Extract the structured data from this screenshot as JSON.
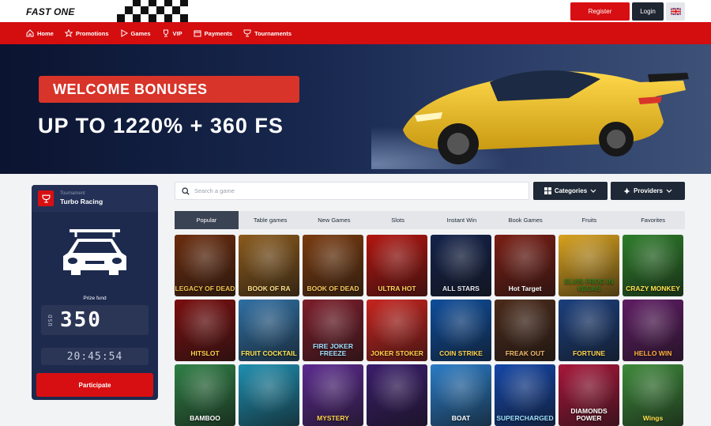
{
  "header": {
    "logo_main": "FAST",
    "logo_accent": " ONE",
    "register_label": "Register",
    "login_label": "Login",
    "language_icon": "uk-flag-icon"
  },
  "nav": {
    "items": [
      {
        "label": "Home",
        "icon": "home-icon"
      },
      {
        "label": "Promotions",
        "icon": "star-icon"
      },
      {
        "label": "Games",
        "icon": "play-icon"
      },
      {
        "label": "VIP",
        "icon": "trophy-icon"
      },
      {
        "label": "Payments",
        "icon": "wallet-icon"
      },
      {
        "label": "Tournaments",
        "icon": "cup-icon"
      }
    ]
  },
  "hero": {
    "tag": "WELCOME BONUSES",
    "headline": "UP TO 1220% + 360 FS"
  },
  "tournament": {
    "subtitle": "Tournament",
    "title": "Turbo Racing",
    "prize_label": "Prize fund",
    "currency": "USD",
    "prize_value": "350",
    "timer": "20:45:54",
    "participate_label": "Participate"
  },
  "search": {
    "placeholder": "Search a game",
    "value": ""
  },
  "filters": {
    "categories_label": "Categories",
    "providers_label": "Providers"
  },
  "tabs": [
    "Popular",
    "Table games",
    "New Games",
    "Slots",
    "Instant Win",
    "Book Games",
    "Fruits",
    "Favorites"
  ],
  "active_tab": "Popular",
  "games": [
    {
      "name": "LEGACY OF DEAD",
      "bg": "#6b2c0d",
      "fg": "#f2c24a"
    },
    {
      "name": "BOOK OF RA",
      "bg": "#8a5a1c",
      "fg": "#ffe08a"
    },
    {
      "name": "BOOK OF DEAD",
      "bg": "#7a3b0f",
      "fg": "#f7c95b"
    },
    {
      "name": "ULTRA HOT",
      "bg": "#b3150f",
      "fg": "#ffd35a"
    },
    {
      "name": "ALL STARS",
      "bg": "#14224a",
      "fg": "#e6e9f2"
    },
    {
      "name": "Hot Target",
      "bg": "#7a1e14",
      "fg": "#ffffff"
    },
    {
      "name": "ELVIS FROG IN VEGAS",
      "bg": "#d9a21e",
      "fg": "#2c7a1c"
    },
    {
      "name": "CRAZY MONKEY",
      "bg": "#2d7d2a",
      "fg": "#ffe24d"
    },
    {
      "name": "HITSLOT",
      "bg": "#7a0f0f",
      "fg": "#ffd24a"
    },
    {
      "name": "FRUIT COCKTAIL",
      "bg": "#2f6fa3",
      "fg": "#ffe24d"
    },
    {
      "name": "FIRE JOKER FREEZE",
      "bg": "#7d1d2a",
      "fg": "#9fe0ff"
    },
    {
      "name": "JOKER STOKER",
      "bg": "#c8241e",
      "fg": "#ffd24a"
    },
    {
      "name": "COIN STRIKE",
      "bg": "#0e4d9c",
      "fg": "#ffd24a"
    },
    {
      "name": "FREAK OUT",
      "bg": "#4a2a1a",
      "fg": "#f0b86a"
    },
    {
      "name": "FORTUNE",
      "bg": "#1b3f7d",
      "fg": "#ffd24a"
    },
    {
      "name": "HELLO WIN",
      "bg": "#5e1c63",
      "fg": "#ffb13a"
    },
    {
      "name": "BAMBOO",
      "bg": "#2f7f45",
      "fg": "#ffffff"
    },
    {
      "name": "",
      "bg": "#1e8fb0",
      "fg": "#ffffff"
    },
    {
      "name": "MYSTERY",
      "bg": "#5b2a8f",
      "fg": "#ffd24a"
    },
    {
      "name": "",
      "bg": "#3a1d6b",
      "fg": "#ffffff"
    },
    {
      "name": "BOAT",
      "bg": "#2a7cc7",
      "fg": "#ffffff"
    },
    {
      "name": "SUPERCHARGED",
      "bg": "#1446a8",
      "fg": "#9fe0ff"
    },
    {
      "name": "DIAMONDS POWER",
      "bg": "#a8163a",
      "fg": "#ffffff"
    },
    {
      "name": "Wings",
      "bg": "#3d8a3a",
      "fg": "#ffe24d"
    }
  ],
  "colors": {
    "brand_red": "#d40d0f",
    "dark": "#1e2836",
    "panel": "#1d2a4e"
  }
}
